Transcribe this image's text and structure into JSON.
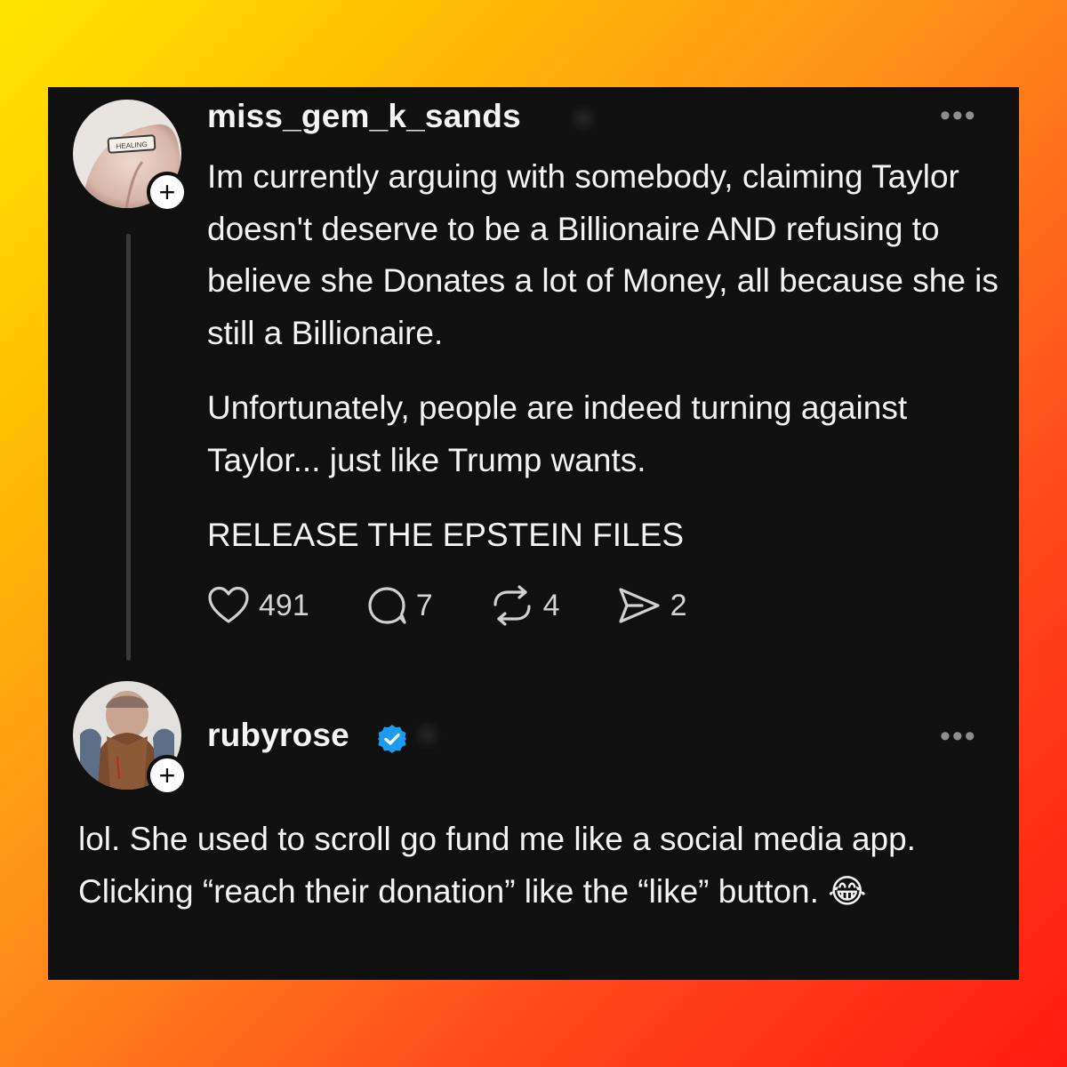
{
  "post": {
    "username": "miss_gem_k_sands",
    "avatar_label": "HEALING",
    "paragraphs": [
      "Im currently arguing with somebody, claiming Taylor doesn't deserve to be a Billionaire AND refusing to believe she Donates a lot of Money, all because she is still a Billionaire.",
      "Unfortunately, people are indeed turning against Taylor... just like Trump wants.",
      "RELEASE THE EPSTEIN FILES"
    ],
    "likes": "491",
    "replies": "7",
    "reposts": "4",
    "shares": "2"
  },
  "reply": {
    "username": "rubyrose",
    "verified": true,
    "text": "lol. She used to scroll go fund me like a social media app. Clicking “reach their donation” like the “like” button. 😂"
  },
  "icons": {
    "like": "heart-icon",
    "reply": "comment-bubble-icon",
    "repost": "repost-icon",
    "share": "send-icon",
    "more": "more-options-icon",
    "follow": "plus-icon",
    "verified": "verified-badge-icon"
  },
  "colors": {
    "card_bg": "#101010",
    "text": "#f3f3f3",
    "muted": "#8e8e8e",
    "verified": "#1d9bf0"
  }
}
